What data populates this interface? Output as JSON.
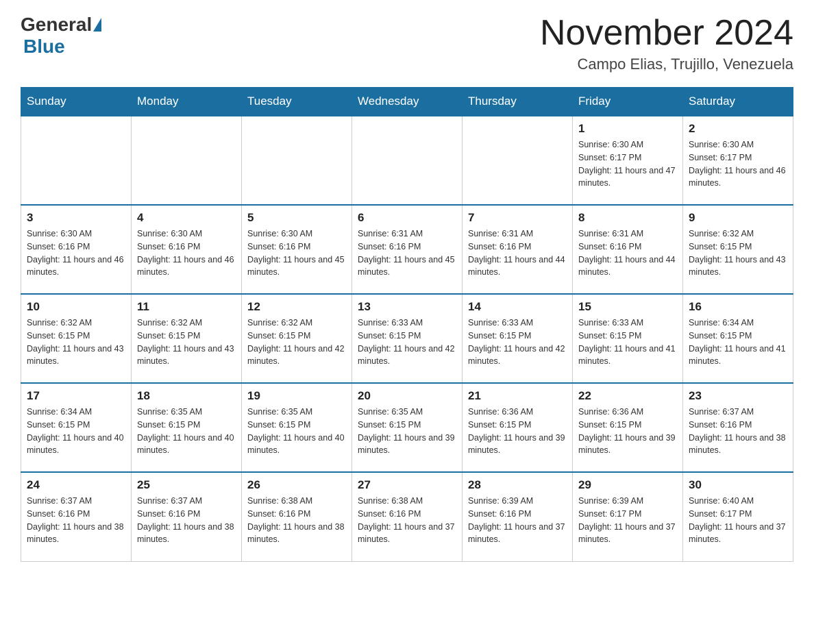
{
  "logo": {
    "general": "General",
    "blue": "Blue"
  },
  "title": "November 2024",
  "location": "Campo Elias, Trujillo, Venezuela",
  "weekdays": [
    "Sunday",
    "Monday",
    "Tuesday",
    "Wednesday",
    "Thursday",
    "Friday",
    "Saturday"
  ],
  "weeks": [
    [
      {
        "day": "",
        "info": ""
      },
      {
        "day": "",
        "info": ""
      },
      {
        "day": "",
        "info": ""
      },
      {
        "day": "",
        "info": ""
      },
      {
        "day": "",
        "info": ""
      },
      {
        "day": "1",
        "info": "Sunrise: 6:30 AM\nSunset: 6:17 PM\nDaylight: 11 hours and 47 minutes."
      },
      {
        "day": "2",
        "info": "Sunrise: 6:30 AM\nSunset: 6:17 PM\nDaylight: 11 hours and 46 minutes."
      }
    ],
    [
      {
        "day": "3",
        "info": "Sunrise: 6:30 AM\nSunset: 6:16 PM\nDaylight: 11 hours and 46 minutes."
      },
      {
        "day": "4",
        "info": "Sunrise: 6:30 AM\nSunset: 6:16 PM\nDaylight: 11 hours and 46 minutes."
      },
      {
        "day": "5",
        "info": "Sunrise: 6:30 AM\nSunset: 6:16 PM\nDaylight: 11 hours and 45 minutes."
      },
      {
        "day": "6",
        "info": "Sunrise: 6:31 AM\nSunset: 6:16 PM\nDaylight: 11 hours and 45 minutes."
      },
      {
        "day": "7",
        "info": "Sunrise: 6:31 AM\nSunset: 6:16 PM\nDaylight: 11 hours and 44 minutes."
      },
      {
        "day": "8",
        "info": "Sunrise: 6:31 AM\nSunset: 6:16 PM\nDaylight: 11 hours and 44 minutes."
      },
      {
        "day": "9",
        "info": "Sunrise: 6:32 AM\nSunset: 6:15 PM\nDaylight: 11 hours and 43 minutes."
      }
    ],
    [
      {
        "day": "10",
        "info": "Sunrise: 6:32 AM\nSunset: 6:15 PM\nDaylight: 11 hours and 43 minutes."
      },
      {
        "day": "11",
        "info": "Sunrise: 6:32 AM\nSunset: 6:15 PM\nDaylight: 11 hours and 43 minutes."
      },
      {
        "day": "12",
        "info": "Sunrise: 6:32 AM\nSunset: 6:15 PM\nDaylight: 11 hours and 42 minutes."
      },
      {
        "day": "13",
        "info": "Sunrise: 6:33 AM\nSunset: 6:15 PM\nDaylight: 11 hours and 42 minutes."
      },
      {
        "day": "14",
        "info": "Sunrise: 6:33 AM\nSunset: 6:15 PM\nDaylight: 11 hours and 42 minutes."
      },
      {
        "day": "15",
        "info": "Sunrise: 6:33 AM\nSunset: 6:15 PM\nDaylight: 11 hours and 41 minutes."
      },
      {
        "day": "16",
        "info": "Sunrise: 6:34 AM\nSunset: 6:15 PM\nDaylight: 11 hours and 41 minutes."
      }
    ],
    [
      {
        "day": "17",
        "info": "Sunrise: 6:34 AM\nSunset: 6:15 PM\nDaylight: 11 hours and 40 minutes."
      },
      {
        "day": "18",
        "info": "Sunrise: 6:35 AM\nSunset: 6:15 PM\nDaylight: 11 hours and 40 minutes."
      },
      {
        "day": "19",
        "info": "Sunrise: 6:35 AM\nSunset: 6:15 PM\nDaylight: 11 hours and 40 minutes."
      },
      {
        "day": "20",
        "info": "Sunrise: 6:35 AM\nSunset: 6:15 PM\nDaylight: 11 hours and 39 minutes."
      },
      {
        "day": "21",
        "info": "Sunrise: 6:36 AM\nSunset: 6:15 PM\nDaylight: 11 hours and 39 minutes."
      },
      {
        "day": "22",
        "info": "Sunrise: 6:36 AM\nSunset: 6:15 PM\nDaylight: 11 hours and 39 minutes."
      },
      {
        "day": "23",
        "info": "Sunrise: 6:37 AM\nSunset: 6:16 PM\nDaylight: 11 hours and 38 minutes."
      }
    ],
    [
      {
        "day": "24",
        "info": "Sunrise: 6:37 AM\nSunset: 6:16 PM\nDaylight: 11 hours and 38 minutes."
      },
      {
        "day": "25",
        "info": "Sunrise: 6:37 AM\nSunset: 6:16 PM\nDaylight: 11 hours and 38 minutes."
      },
      {
        "day": "26",
        "info": "Sunrise: 6:38 AM\nSunset: 6:16 PM\nDaylight: 11 hours and 38 minutes."
      },
      {
        "day": "27",
        "info": "Sunrise: 6:38 AM\nSunset: 6:16 PM\nDaylight: 11 hours and 37 minutes."
      },
      {
        "day": "28",
        "info": "Sunrise: 6:39 AM\nSunset: 6:16 PM\nDaylight: 11 hours and 37 minutes."
      },
      {
        "day": "29",
        "info": "Sunrise: 6:39 AM\nSunset: 6:17 PM\nDaylight: 11 hours and 37 minutes."
      },
      {
        "day": "30",
        "info": "Sunrise: 6:40 AM\nSunset: 6:17 PM\nDaylight: 11 hours and 37 minutes."
      }
    ]
  ]
}
